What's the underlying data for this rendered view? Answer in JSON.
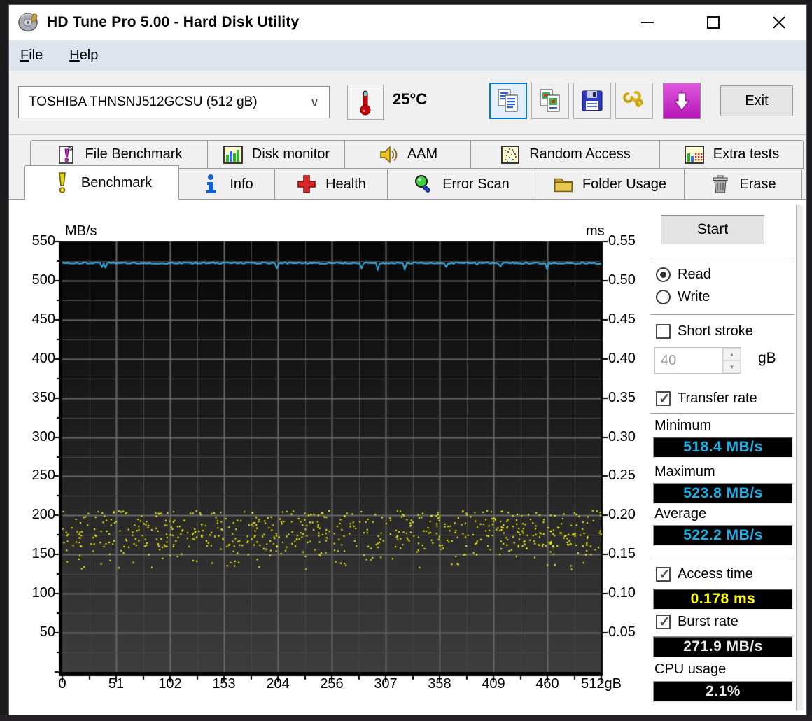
{
  "window": {
    "title": "HD Tune Pro 5.00 - Hard Disk Utility"
  },
  "menu": {
    "items": [
      {
        "label": "File"
      },
      {
        "label": "Help"
      }
    ]
  },
  "toolbar": {
    "drive_select": "TOSHIBA THNSNJ512GCSU (512 gB)",
    "temperature": "25°C",
    "exit_label": "Exit"
  },
  "tabs": {
    "row1": [
      {
        "label": "File Benchmark",
        "icon": "file-benchmark-icon",
        "active": false
      },
      {
        "label": "Disk monitor",
        "icon": "disk-monitor-icon",
        "active": false
      },
      {
        "label": "AAM",
        "icon": "speaker-icon",
        "active": false
      },
      {
        "label": "Random Access",
        "icon": "random-access-icon",
        "active": false
      },
      {
        "label": "Extra tests",
        "icon": "extra-tests-icon",
        "active": false
      }
    ],
    "row2": [
      {
        "label": "Benchmark",
        "icon": "benchmark-icon",
        "active": true
      },
      {
        "label": "Info",
        "icon": "info-icon",
        "active": false
      },
      {
        "label": "Health",
        "icon": "health-icon",
        "active": false
      },
      {
        "label": "Error Scan",
        "icon": "error-scan-icon",
        "active": false
      },
      {
        "label": "Folder Usage",
        "icon": "folder-icon",
        "active": false
      },
      {
        "label": "Erase",
        "icon": "trash-icon",
        "active": false
      }
    ]
  },
  "benchmark_panel": {
    "start_label": "Start",
    "read_label": "Read",
    "write_label": "Write",
    "read_selected": true,
    "short_stroke_label": "Short stroke",
    "short_stroke_checked": false,
    "short_stroke_value": "40",
    "short_stroke_unit": "gB",
    "transfer_rate_label": "Transfer rate",
    "transfer_rate_checked": true,
    "minimum_label": "Minimum",
    "minimum_value": "518.4 MB/s",
    "maximum_label": "Maximum",
    "maximum_value": "523.8 MB/s",
    "average_label": "Average",
    "average_value": "522.2 MB/s",
    "access_time_label": "Access time",
    "access_time_checked": true,
    "access_time_value": "0.178 ms",
    "burst_rate_label": "Burst rate",
    "burst_rate_checked": true,
    "burst_rate_value": "271.9 MB/s",
    "cpu_usage_label": "CPU usage",
    "cpu_usage_value": "2.1%"
  },
  "colors": {
    "lcd_cyan": "#17b2e8",
    "lcd_yellow": "#ffff00",
    "lcd_white": "#e8e8e8",
    "focus_blue": "#0078d7",
    "transfer_line": "#35aae4",
    "access_dots": "#ffff00"
  },
  "chart_data": {
    "type": "line+scatter",
    "title": "",
    "x_axis": {
      "min": 0,
      "max": 512,
      "unit": "gB",
      "ticks": [
        "0",
        "51",
        "102",
        "153",
        "204",
        "256",
        "307",
        "358",
        "409",
        "460",
        "512gB"
      ]
    },
    "left_axis": {
      "label": "MB/s",
      "min": 0,
      "max": 550,
      "tick_step": 50,
      "ticks": [
        550,
        500,
        450,
        400,
        350,
        300,
        250,
        200,
        150,
        100,
        50
      ]
    },
    "right_axis": {
      "label": "ms",
      "min": 0,
      "max": 0.55,
      "tick_step": 0.05,
      "ticks": [
        "0.55",
        "0.50",
        "0.45",
        "0.40",
        "0.35",
        "0.30",
        "0.25",
        "0.20",
        "0.15",
        "0.10",
        "0.05"
      ]
    },
    "grid": {
      "on": true,
      "color_major": "#686868",
      "color_minor": "#474747",
      "bg_top": "#060606",
      "bg_bottom": "#3d3d3d",
      "minor_x_divisions": 20,
      "minor_y_step": 25
    },
    "series": [
      {
        "name": "Transfer rate",
        "axis": "left",
        "type": "line",
        "color": "#35aae4",
        "summary": {
          "min": 518.4,
          "max": 523.8,
          "avg": 522.2
        },
        "gen": {
          "samples": 300,
          "base": 522.3,
          "noise": 1.0,
          "dip_chance": 0.035,
          "dip_min": 2,
          "dip_max": 9,
          "seed": 20
        }
      },
      {
        "name": "Access time",
        "axis": "right",
        "type": "scatter",
        "color": "#ffff00",
        "summary": {
          "avg": 0.178
        },
        "gen": {
          "count": 680,
          "seed": 77,
          "bands": [
            {
              "p": 0.8,
              "min": 0.16,
              "max": 0.206
            },
            {
              "p": 0.13,
              "min": 0.148,
              "max": 0.162
            },
            {
              "p": 0.07,
              "min": 0.131,
              "max": 0.15
            }
          ]
        }
      }
    ]
  }
}
